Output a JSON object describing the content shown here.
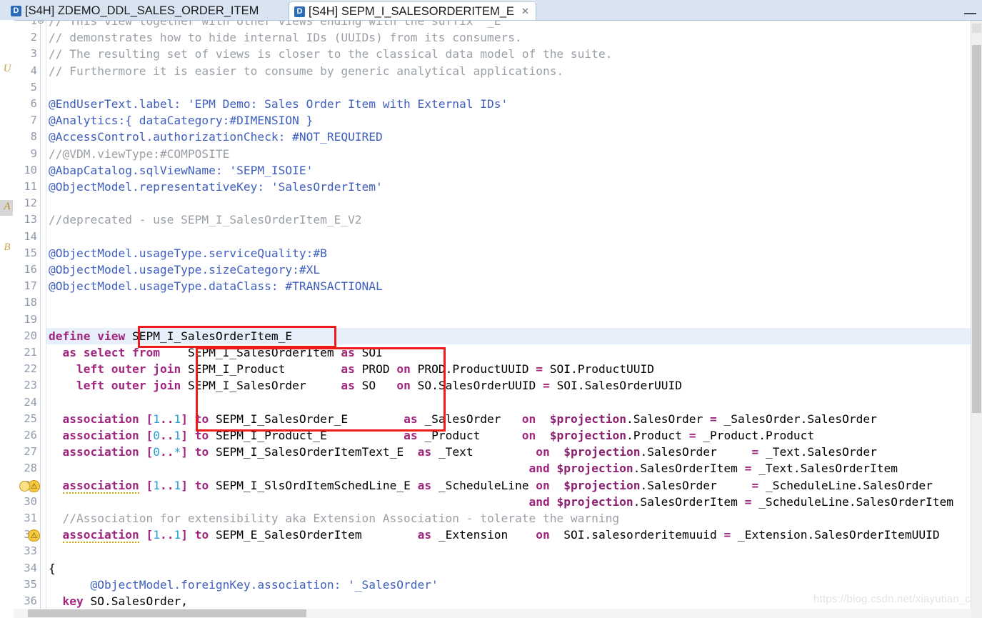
{
  "window": {
    "minimize_label": "—"
  },
  "tabs": [
    {
      "icon": "D",
      "label": "[S4H] ZDEMO_DDL_SALES_ORDER_ITEM",
      "active": false,
      "close": ""
    },
    {
      "icon": "D",
      "label": "[S4H] SEPM_I_SALESORDERITEM_E",
      "active": true,
      "close": "✕"
    }
  ],
  "left_toolbar_glyphs": [
    "U",
    "A",
    "B"
  ],
  "editor": {
    "language": "ABAP CDS DDL",
    "current_line": 20,
    "first_visible_line": 1,
    "last_visible_line": 36,
    "fold_marker": "⊖",
    "markers": [
      {
        "line": 29,
        "type": "warning-with-quickfix",
        "glyph": "⚠"
      },
      {
        "line": 32,
        "type": "warning",
        "glyph": "⚠"
      }
    ],
    "lines": [
      {
        "n": 1,
        "text": "// This view together with other views ending with the suffix '_E'"
      },
      {
        "n": 2,
        "text": "// demonstrates how to hide internal IDs (UUIDs) from its consumers."
      },
      {
        "n": 3,
        "text": "// The resulting set of views is closer to the classical data model of the suite."
      },
      {
        "n": 4,
        "text": "// Furthermore it is easier to consume by generic analytical applications."
      },
      {
        "n": 5,
        "text": ""
      },
      {
        "n": 6,
        "text": "@EndUserText.label: 'EPM Demo: Sales Order Item with External IDs'"
      },
      {
        "n": 7,
        "text": "@Analytics:{ dataCategory:#DIMENSION }"
      },
      {
        "n": 8,
        "text": "@AccessControl.authorizationCheck: #NOT_REQUIRED"
      },
      {
        "n": 9,
        "text": "//@VDM.viewType:#COMPOSITE"
      },
      {
        "n": 10,
        "text": "@AbapCatalog.sqlViewName: 'SEPM_ISOIE'"
      },
      {
        "n": 11,
        "text": "@ObjectModel.representativeKey: 'SalesOrderItem'"
      },
      {
        "n": 12,
        "text": ""
      },
      {
        "n": 13,
        "text": "//deprecated - use SEPM_I_SalesOrderItem_E_V2"
      },
      {
        "n": 14,
        "text": ""
      },
      {
        "n": 15,
        "text": "@ObjectModel.usageType.serviceQuality:#B"
      },
      {
        "n": 16,
        "text": "@ObjectModel.usageType.sizeCategory:#XL"
      },
      {
        "n": 17,
        "text": "@ObjectModel.usageType.dataClass: #TRANSACTIONAL"
      },
      {
        "n": 18,
        "text": ""
      },
      {
        "n": 19,
        "text": ""
      },
      {
        "n": 20,
        "text": "define view SEPM_I_SalesOrderItem_E"
      },
      {
        "n": 21,
        "text": "  as select from    SEPM_I_SalesOrderItem as SOI"
      },
      {
        "n": 22,
        "text": "    left outer join SEPM_I_Product        as PROD on PROD.ProductUUID = SOI.ProductUUID"
      },
      {
        "n": 23,
        "text": "    left outer join SEPM_I_SalesOrder     as SO   on SO.SalesOrderUUID = SOI.SalesOrderUUID"
      },
      {
        "n": 24,
        "text": ""
      },
      {
        "n": 25,
        "text": "  association [1..1] to SEPM_I_SalesOrder_E        as _SalesOrder   on  $projection.SalesOrder = _SalesOrder.SalesOrder"
      },
      {
        "n": 26,
        "text": "  association [0..1] to SEPM_I_Product_E           as _Product      on  $projection.Product = _Product.Product"
      },
      {
        "n": 27,
        "text": "  association [0..*] to SEPM_I_SalesOrderItemText_E  as _Text         on  $projection.SalesOrder     = _Text.SalesOrder"
      },
      {
        "n": 28,
        "text": "                                                                     and $projection.SalesOrderItem = _Text.SalesOrderItem"
      },
      {
        "n": 29,
        "text": "  association [1..1] to SEPM_I_SlsOrdItemSchedLine_E as _ScheduleLine on  $projection.SalesOrder     = _ScheduleLine.SalesOrder"
      },
      {
        "n": 30,
        "text": "                                                                     and $projection.SalesOrderItem = _ScheduleLine.SalesOrderItem"
      },
      {
        "n": 31,
        "text": "  //Association for extensibility aka Extension Association - tolerate the warning"
      },
      {
        "n": 32,
        "text": "  association [1..1] to SEPM_E_SalesOrderItem        as _Extension    on  SOI.salesorderitemuuid = _Extension.SalesOrderItemUUID"
      },
      {
        "n": 33,
        "text": ""
      },
      {
        "n": 34,
        "text": "{"
      },
      {
        "n": 35,
        "text": "      @ObjectModel.foreignKey.association: '_SalesOrder'"
      },
      {
        "n": 36,
        "text": "  key SO.SalesOrder,"
      }
    ]
  },
  "annotations": {
    "red_boxes": [
      {
        "label": "view-name-highlight",
        "target": "SEPM_I_SalesOrderItem_E"
      },
      {
        "label": "data-sources-highlight",
        "target": "SEPM_I_SalesOrderItem / SEPM_I_Product / SEPM_I_SalesOrder"
      }
    ],
    "color": "#ee1b1b"
  },
  "watermark": {
    "text": "https://blog.csdn.net/xiayutian_c"
  },
  "colors": {
    "comment": "#9aa0a6",
    "annotation": "#3f5fbf",
    "keyword": "#a0257e",
    "number": "#2a9fd6",
    "string": "#3f5fbf",
    "identifier": "#000000",
    "current_line_bg": "#e7effa",
    "tabbar_bg": "#d9e4f2",
    "redbox": "#ee1b1b"
  }
}
